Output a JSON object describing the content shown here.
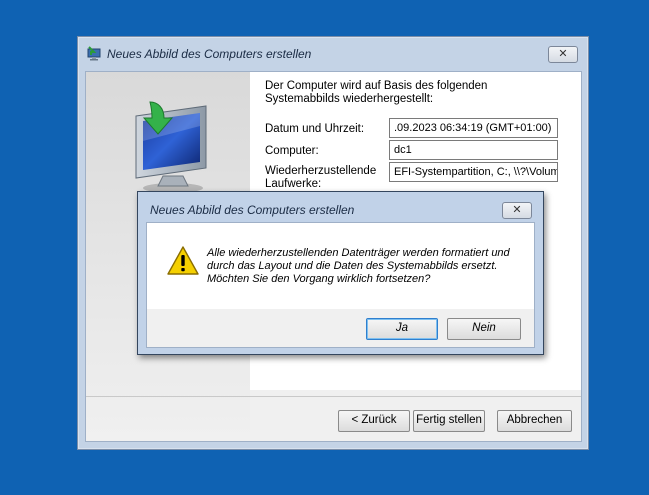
{
  "main_window": {
    "title": "Neues Abbild des Computers erstellen",
    "close_label": "✕",
    "intro": "Der Computer wird auf Basis des folgenden Systemabbilds wiederhergestellt:",
    "fields": {
      "datetime": {
        "label": "Datum und Uhrzeit:",
        "value": ".09.2023 06:34:19 (GMT+01:00)"
      },
      "computer": {
        "label": "Computer:",
        "value": "dc1"
      },
      "drives": {
        "label_line1": "Wiederherzustellende",
        "label_line2": "Laufwerke:",
        "value": "EFI-Systempartition, C:, \\\\?\\Volum"
      }
    },
    "buttons": {
      "back": "< Zurück",
      "finish": "Fertig stellen",
      "cancel": "Abbrechen"
    }
  },
  "dialog": {
    "title": "Neues Abbild des Computers erstellen",
    "close_label": "✕",
    "message_lines": [
      "Alle wiederherzustellenden Datenträger werden formatiert und",
      "durch das Layout und die Daten des Systemabbilds ersetzt.",
      "Möchten Sie den Vorgang wirklich fortsetzen?"
    ],
    "buttons": {
      "yes": "Ja",
      "no": "Nein"
    },
    "icon": "warning-icon"
  },
  "colors": {
    "desktop": "#0f62b3",
    "chrome": "#c4d3e6",
    "warning": "#f5d000"
  }
}
